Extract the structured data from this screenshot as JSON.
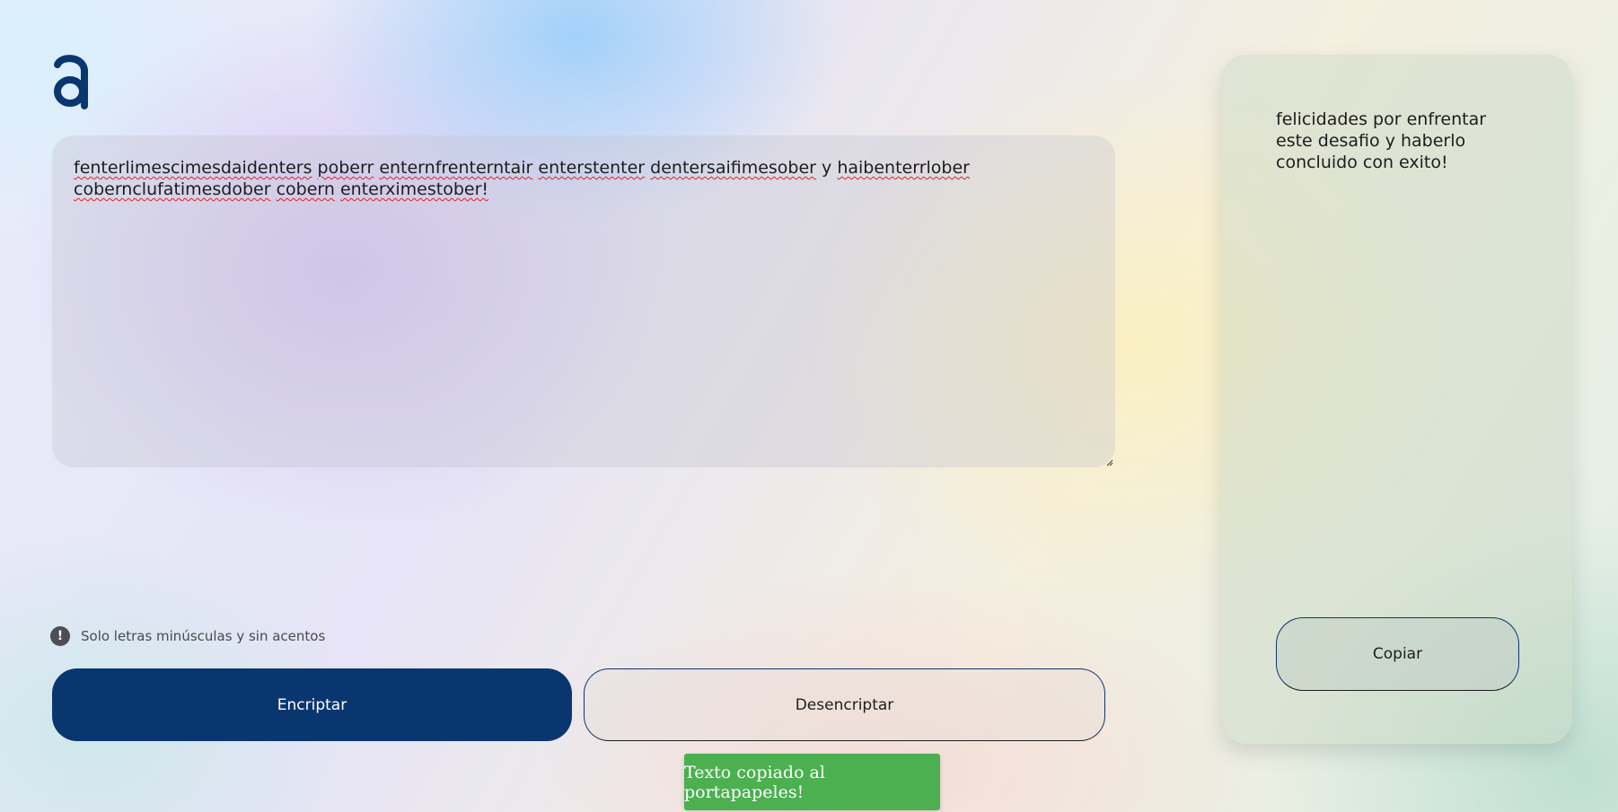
{
  "logo": {
    "letter": "a",
    "color": "#0a3670"
  },
  "input": {
    "words": [
      "fenterlimescimesdaidenters",
      "poberr",
      "enternfrenterntair",
      "enterstenter",
      "dentersaifimesober",
      "y",
      "haibenterrlober",
      "cobernclufatimesdober",
      "cobern",
      "enterximestober!"
    ],
    "misspelled": [
      true,
      true,
      true,
      true,
      true,
      false,
      true,
      true,
      true,
      true
    ]
  },
  "hint": {
    "icon": "exclamation-circle-icon",
    "text": "Solo letras minúsculas y sin acentos"
  },
  "buttons": {
    "encrypt_label": "Encriptar",
    "decrypt_label": "Desencriptar",
    "copy_label": "Copiar"
  },
  "output": {
    "text": "felicidades por enfrentar este desafio y haberlo concluido con exito!"
  },
  "toast": {
    "message": "Texto copiado al portapapeles!"
  },
  "colors": {
    "primary": "#0a3670",
    "toast": "#4caf50"
  }
}
